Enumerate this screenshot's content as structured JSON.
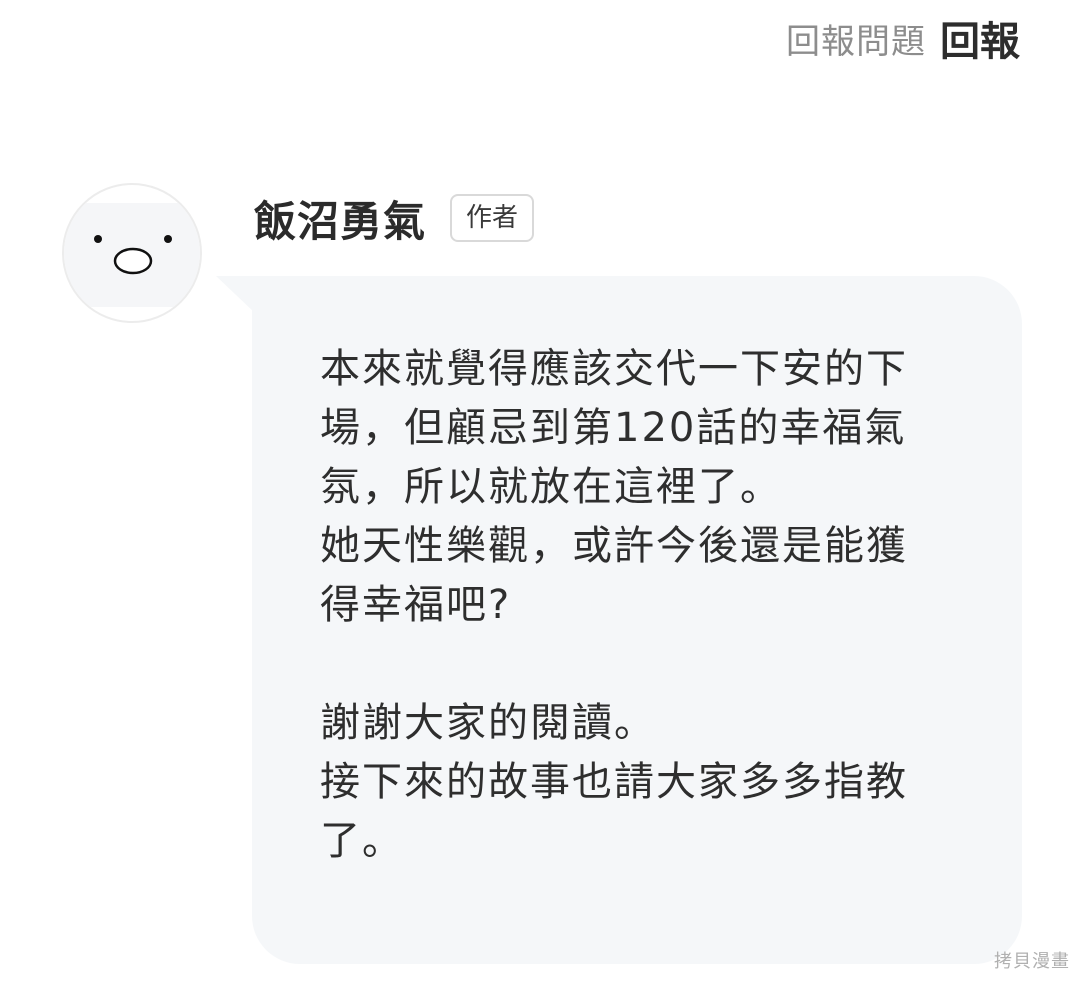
{
  "header": {
    "report_issue_label": "回報問題",
    "report_label": "回報"
  },
  "comment": {
    "author_name": "飯沼勇氣",
    "author_badge": "作者",
    "lines": [
      "本來就覺得應該交代一下安的下",
      "場，但顧忌到第120話的幸福氣",
      "氛，所以就放在這裡了。",
      "她天性樂觀，或許今後還是能獲",
      "得幸福吧?",
      "",
      "謝謝大家的閱讀。",
      "接下來的故事也請大家多多指教",
      "了。"
    ]
  },
  "watermark": "拷貝漫畫",
  "icons": {
    "avatar": "default-face-avatar-icon"
  },
  "colors": {
    "bubble_bg": "#f5f7f9",
    "text": "#2e2e2e",
    "muted": "#8d8d8d"
  }
}
